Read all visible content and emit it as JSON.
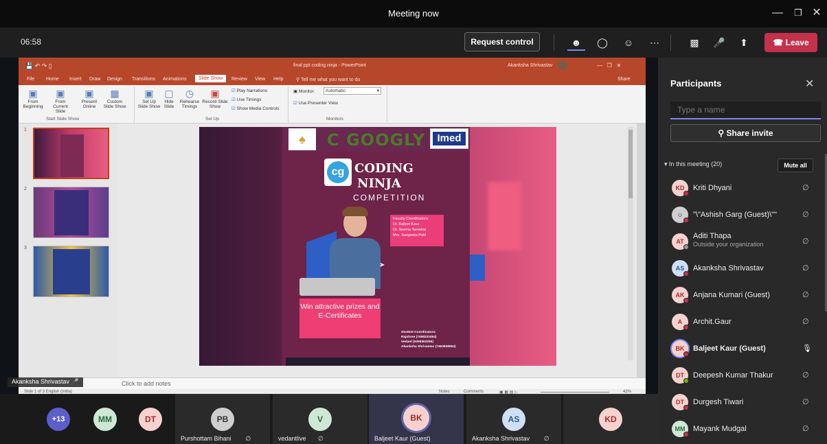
{
  "window": {
    "title": "Meeting now",
    "controls": [
      "minimize",
      "maximize",
      "close"
    ]
  },
  "toolbar": {
    "timer": "06:58",
    "request_control": "Request control",
    "leave": "Leave",
    "icons": [
      "participants-icon",
      "chat-icon",
      "reactions-icon",
      "more-icon",
      "camera-off-icon",
      "mic-off-icon",
      "share-icon"
    ]
  },
  "ppt": {
    "window_title": "final ppt coding ninja  -  PowerPoint",
    "user": "Akanksha Shrivastav",
    "share": "Share",
    "menu": [
      "File",
      "Home",
      "Insert",
      "Draw",
      "Design",
      "Transitions",
      "Animations",
      "Slide Show",
      "Review",
      "View",
      "Help"
    ],
    "tell_me": "Tell me what you want to do",
    "ribbon": {
      "from_beginning": "From Beginning",
      "from_current": "From Current Slide",
      "present_online": "Present Online",
      "custom_slide_show": "Custom Slide Show",
      "start_group": "Start Slide Show",
      "setup_show": "Set Up Slide Show",
      "hide_slide": "Hide Slide",
      "rehearse": "Rehearse Timings",
      "record": "Record Slide Show",
      "play_narrations": "Play Narrations",
      "use_timings": "Use Timings",
      "show_media_controls": "Show Media Controls",
      "setup_group": "Set Up",
      "monitor_label": "Monitor:",
      "monitor_value": "Automatic",
      "use_presenter_view": "Use Presenter View",
      "monitors_group": "Monitors"
    },
    "thumb_numbers": [
      "1",
      "2",
      "3"
    ],
    "slide": {
      "brand1": "C GOOGLY",
      "brand2": "Imed",
      "title1": "CODING",
      "title2": "NINJA",
      "subtitle": "COMPETITION",
      "faculty": [
        "Faculty Coordinators:",
        "Dr. Baljeet Kaur",
        "Dr. Seema Tarnekar",
        "Mrs. Sangeeta Patil"
      ],
      "prize": "Win attractive prizes and E-Certificates",
      "students": [
        "Student Coordinators:",
        "Rajshree (7498220494)",
        "Vedant (9259303295)",
        "Akanksha Shrivastav (7463938063)"
      ]
    },
    "notes": "Click to add notes",
    "status_left": "Slide 1 of 3    English (India)",
    "status_notes": "Notes",
    "status_comments": "Comments",
    "zoom": "42%"
  },
  "presenter_label": "Akanksha Shrivastav",
  "panel": {
    "title": "Participants",
    "search_placeholder": "Type a name",
    "share_invite": "Share invite",
    "in_meeting": "In this meeting (20)",
    "mute_all": "Mute all",
    "people": [
      {
        "initials": "KD",
        "name": "Kriti Dhyani",
        "sub": "",
        "mic": "muted",
        "cls": "c-kd",
        "dot": "#c4314b"
      },
      {
        "initials": "",
        "name": "\"\\\"Ashish Garg (Guest)\\\"\"",
        "sub": "",
        "mic": "muted",
        "cls": "c-grey",
        "dot": "#c4314b"
      },
      {
        "initials": "AT",
        "name": "Aditi Thapa",
        "sub": "Outside your organization",
        "mic": "muted",
        "cls": "c-at",
        "dot": "#9a9a9a"
      },
      {
        "initials": "AS",
        "name": "Akanksha Shrivastav",
        "sub": "",
        "mic": "muted",
        "cls": "c-as",
        "dot": "#c4314b"
      },
      {
        "initials": "AK",
        "name": "Anjana Kumari (Guest)",
        "sub": "",
        "mic": "muted",
        "cls": "c-ak",
        "dot": "#c4314b"
      },
      {
        "initials": "A",
        "name": "Archit.Gaur",
        "sub": "",
        "mic": "muted",
        "cls": "c-a",
        "dot": "#c4314b"
      },
      {
        "initials": "BK",
        "name": "Baljeet Kaur (Guest)",
        "sub": "",
        "mic": "on",
        "cls": "c-bk",
        "dot": "#c4314b"
      },
      {
        "initials": "DT",
        "name": "Deepesh Kumar Thakur",
        "sub": "",
        "mic": "muted",
        "cls": "c-dt",
        "dot": "#6bb700"
      },
      {
        "initials": "DT",
        "name": "Durgesh Tiwari",
        "sub": "",
        "mic": "muted",
        "cls": "c-dt",
        "dot": "#c4314b"
      },
      {
        "initials": "MM",
        "name": "Mayank Mudgal",
        "sub": "",
        "mic": "muted",
        "cls": "c-mm",
        "dot": "#c4314b"
      }
    ]
  },
  "strip": {
    "overflow": "+13",
    "small": [
      {
        "initials": "MM",
        "cls": "c-mm"
      },
      {
        "initials": "DT",
        "cls": "c-dt"
      }
    ],
    "tiles": [
      {
        "initials": "PB",
        "name": "Purshottam Bihani",
        "cls": "c-grey"
      },
      {
        "initials": "V",
        "name": "vedantlive",
        "cls": "c-mm"
      },
      {
        "initials": "BK",
        "name": "Baljeet Kaur (Guest)",
        "cls": "c-bk"
      },
      {
        "initials": "AS",
        "name": "Akanksha Shrivastav",
        "cls": "c-as"
      },
      {
        "initials": "KD",
        "name": "",
        "cls": "c-kd"
      }
    ]
  }
}
